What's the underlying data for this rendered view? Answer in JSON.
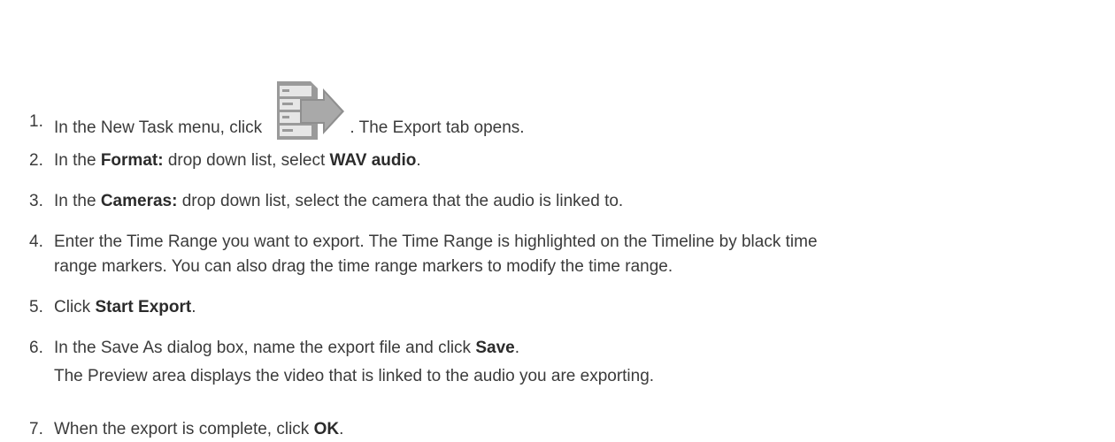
{
  "steps": [
    {
      "number": "1.",
      "before_icon": "In the New Task menu, click ",
      "icon": "export-icon",
      "after_icon": ". The Export tab opens."
    },
    {
      "number": "2.",
      "t1": "In the ",
      "b1": "Format:",
      "t2": " drop down list, select ",
      "b2": "WAV audio",
      "t3": "."
    },
    {
      "number": "3.",
      "t1": "In the ",
      "b1": "Cameras:",
      "t2": " drop down list, select the camera that the audio is linked to."
    },
    {
      "number": "4.",
      "line1": "Enter the Time Range you want to export. The Time Range is highlighted on the Timeline by black time",
      "line2": "range markers. You can also drag the time range markers to modify the time range."
    },
    {
      "number": "5.",
      "t1": "Click ",
      "b1": "Start Export",
      "t2": "."
    },
    {
      "number": "6.",
      "t1": "In the Save As dialog box, name the export file and click ",
      "b1": "Save",
      "t2": "."
    },
    {
      "number": "7.",
      "t1": "When the export is complete, click ",
      "b1": "OK",
      "t2": "."
    }
  ],
  "note": "The Preview area displays the video that is linked to the audio you are exporting.",
  "colors": {
    "text": "#3b3b3b",
    "icon_gray": "#9a9a9a",
    "icon_light": "#e6e6e6"
  }
}
